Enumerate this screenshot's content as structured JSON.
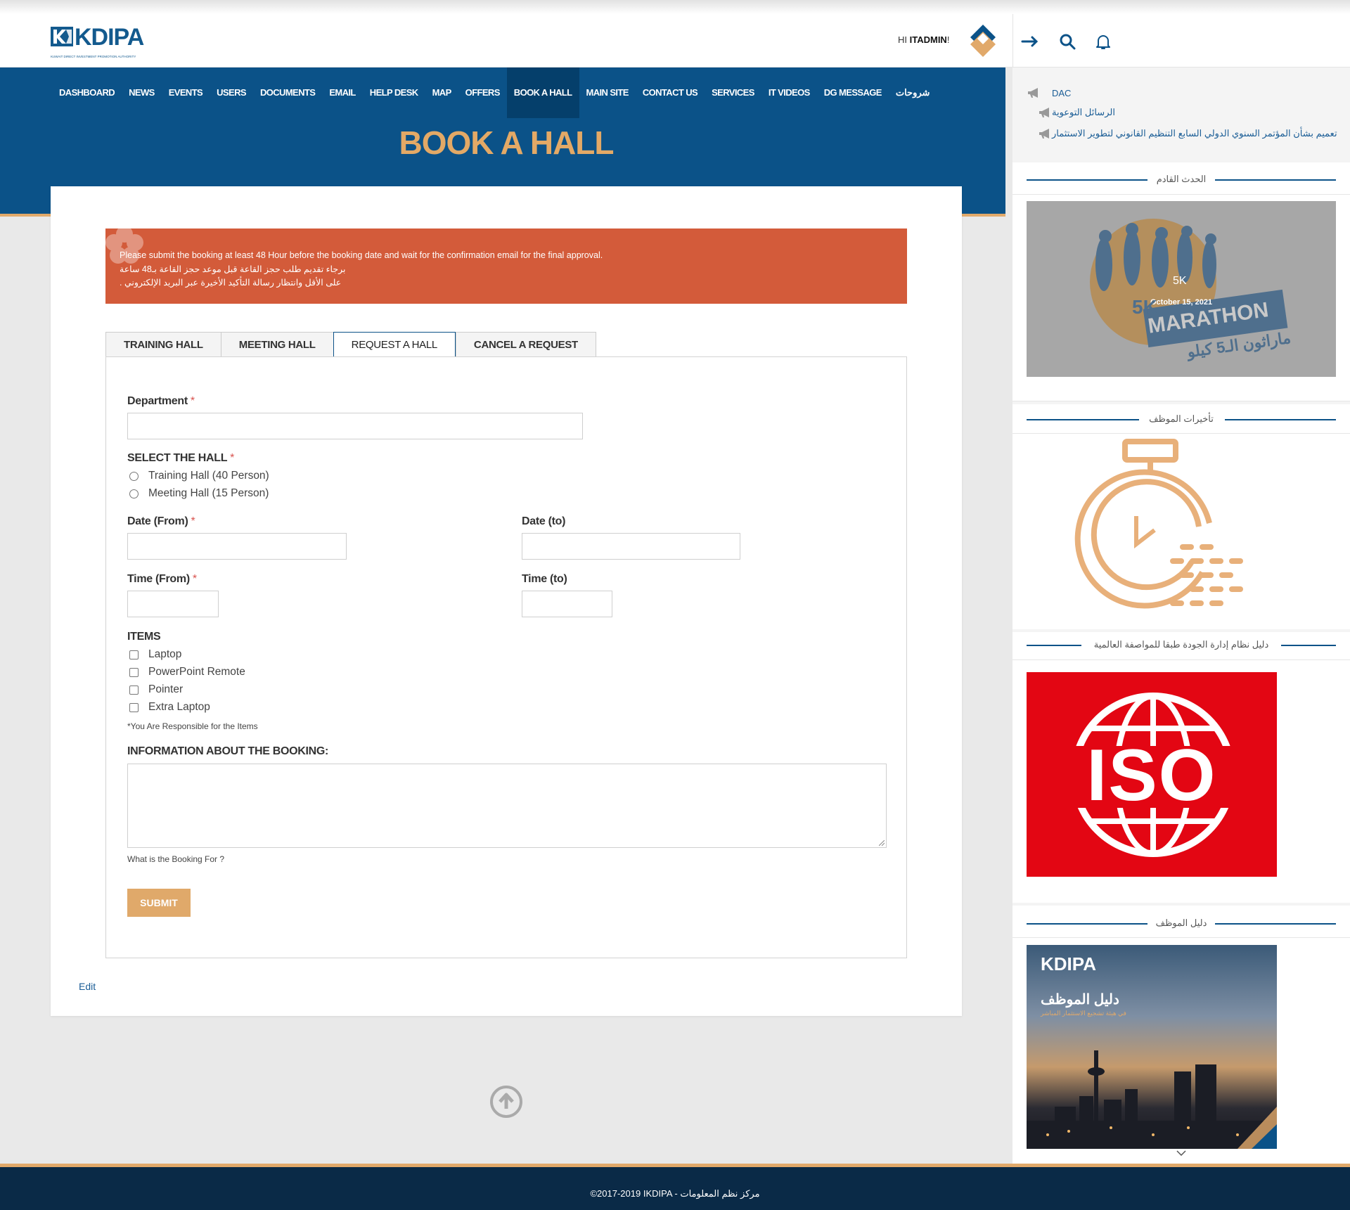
{
  "header": {
    "logo_text": "KDIPA",
    "logo_subtext": "KUWAIT DIRECT INVESTMENT PROMOTION AUTHORITY",
    "greeting_prefix": "HI",
    "username": "ITADMIN",
    "greeting_suffix": "!"
  },
  "nav": {
    "items": [
      "DASHBOARD",
      "NEWS",
      "EVENTS",
      "USERS",
      "DOCUMENTS",
      "EMAIL",
      "HELP DESK",
      "MAP",
      "OFFERS",
      "BOOK A HALL",
      "MAIN SITE",
      "CONTACT US",
      "SERVICES",
      "IT VIDEOS",
      "DG MESSAGE",
      "شروحات"
    ],
    "active": "BOOK A HALL"
  },
  "page": {
    "title": "BOOK A HALL"
  },
  "alert": {
    "line1": "Please submit the booking at least 48 Hour before the booking date and wait for the confirmation email for the final approval.",
    "line2": "برجاء تقديم طلب حجز القاعة قبل موعد حجز القاعة بـ48 ساعة",
    "line3": "على الأقل وانتظار رسالة التأكيد الأخيرة عبر البريد الإلكتروني ."
  },
  "tabs": [
    "TRAINING HALL",
    "MEETING HALL",
    "REQUEST A HALL",
    "CANCEL A REQUEST"
  ],
  "active_tab": "REQUEST A HALL",
  "form": {
    "department_label": "Department",
    "department_value": "",
    "required_mark": "*",
    "hall_label": "SELECT THE HALL",
    "hall_options": [
      "Training Hall (40 Person)",
      "Meeting Hall (15 Person)"
    ],
    "date_from_label": "Date (From)",
    "date_to_label": "Date (to)",
    "time_from_label": "Time (From)",
    "time_to_label": "Time (to)",
    "items_label": "ITEMS",
    "items": [
      "Laptop",
      "PowerPoint Remote",
      "Pointer",
      "Extra Laptop"
    ],
    "items_note": "*You Are Responsible for the Items",
    "info_label": "INFORMATION ABOUT THE BOOKING:",
    "info_hint": "What is the Booking For ?",
    "submit_label": "SUBMIT"
  },
  "edit_label": "Edit",
  "sidebar": {
    "news": [
      "DAC",
      "الرسائل التوعوية",
      "تعميم بشأن المؤتمر السنوي الدولي السابع التنظيم القانوني لتطوير الاستثمار"
    ],
    "upcoming_event_title": "الحدث القادم",
    "event_label": "5K",
    "event_date": "October 15, 2021",
    "marathon_5k": "5K",
    "marathon_word": "MARATHON",
    "marathon_arabic": "ماراثون الـ5 كيلو",
    "delays_title": "تأخيرات الموظف",
    "quality_title": "دليل نظام إدارة الجودة طبقا للمواصفة العالمية",
    "iso_text": "ISO",
    "guide_title": "دليل الموظف",
    "guide_logo": "KDIPA",
    "guide_heading": "دليل الموظف",
    "guide_subheading": "في هيئة تشجيع الاستثمار المباشر"
  },
  "footer": {
    "text": "©2017-2019 IKDIPA - مركز نظم المعلومات"
  },
  "colors": {
    "primary": "#0b5288",
    "accent": "#e1a96a",
    "alert": "#d35b3a",
    "footer": "#0a2a47",
    "iso_red": "#e30613"
  }
}
